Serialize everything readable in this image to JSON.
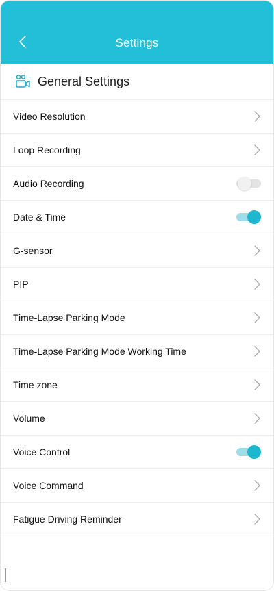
{
  "header": {
    "title": "Settings",
    "back_icon": "chevron-left-icon"
  },
  "section": {
    "title": "General Settings",
    "icon": "settings-group-icon"
  },
  "colors": {
    "accent": "#23bfd8",
    "toggle_on": "#1fb6d0",
    "toggle_off": "#e3e3e3"
  },
  "items": [
    {
      "label": "Video Resolution",
      "control": "chevron"
    },
    {
      "label": "Loop Recording",
      "control": "chevron"
    },
    {
      "label": "Audio Recording",
      "control": "toggle",
      "state": "off"
    },
    {
      "label": "Date & Time",
      "control": "toggle",
      "state": "on"
    },
    {
      "label": "G-sensor",
      "control": "chevron"
    },
    {
      "label": "PIP",
      "control": "chevron"
    },
    {
      "label": "Time-Lapse Parking Mode",
      "control": "chevron"
    },
    {
      "label": "Time-Lapse Parking Mode Working Time",
      "control": "chevron"
    },
    {
      "label": "Time zone",
      "control": "chevron"
    },
    {
      "label": "Volume",
      "control": "chevron"
    },
    {
      "label": "Voice Control",
      "control": "toggle",
      "state": "on"
    },
    {
      "label": "Voice Command",
      "control": "chevron"
    },
    {
      "label": "Fatigue Driving Reminder",
      "control": "chevron"
    }
  ]
}
